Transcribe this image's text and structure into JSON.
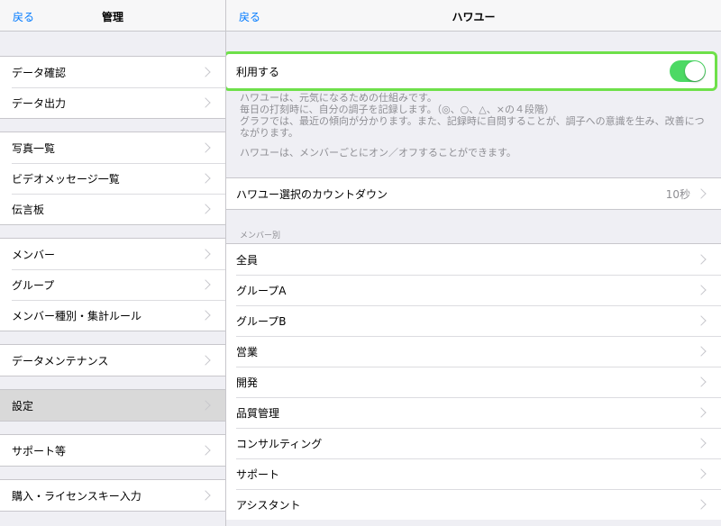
{
  "left": {
    "back_label": "戻る",
    "title": "管理",
    "groups": [
      [
        "データ確認",
        "データ出力"
      ],
      [
        "写真一覧",
        "ビデオメッセージ一覧",
        "伝言板"
      ],
      [
        "メンバー",
        "グループ",
        "メンバー種別・集計ルール"
      ],
      [
        "データメンテナンス"
      ],
      [
        "設定"
      ],
      [
        "サポート等"
      ],
      [
        "購入・ライセンスキー入力"
      ]
    ]
  },
  "right": {
    "back_label": "戻る",
    "title": "ハワユー",
    "toggle": {
      "label": "利用する",
      "state": "on"
    },
    "description": [
      "ハワユーは、元気になるための仕組みです。",
      "毎日の打刻時に、自分の調子を記録します。（◎、○、△、×の４段階）",
      "グラフでは、最近の傾向が分かります。また、記録時に自問することが、調子への意識を生み、改善につながります。"
    ],
    "note": "ハワユーは、メンバーごとにオン／オフすることができます。",
    "countdown": {
      "label": "ハワユー選択のカウントダウン",
      "value": "10秒"
    },
    "member_section_header": "メンバー別",
    "members": [
      "全員",
      "グループA",
      "グループB",
      "営業",
      "開発",
      "品質管理",
      "コンサルティング",
      "サポート",
      "アシスタント"
    ]
  },
  "colors": {
    "accent": "#007aff",
    "switch_on": "#4cd964",
    "highlight_border": "#6ee04a",
    "selected_row": "#d9d9d9"
  }
}
